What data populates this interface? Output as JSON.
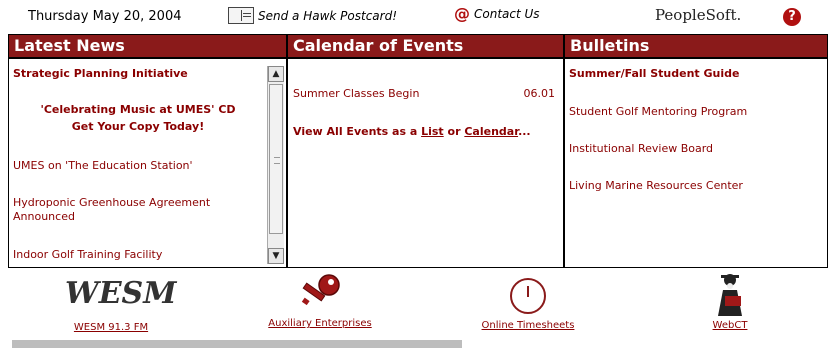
{
  "topbar": {
    "date": "Thursday May 20, 2004",
    "postcard_label": "Send a Hawk Postcard!",
    "contact_label": "Contact Us",
    "logo_text": "PeopleSoft.",
    "help_icon_glyph": "?"
  },
  "panels": {
    "news": {
      "title": "Latest News",
      "items": [
        "Strategic Planning Initiative",
        "'Celebrating Music at UMES' CD",
        "Get Your Copy Today!",
        "UMES on 'The Education Station'",
        "Hydroponic Greenhouse Agreement Announced",
        "Indoor Golf Training Facility"
      ]
    },
    "calendar": {
      "title": "Calendar of Events",
      "event_name": "Summer Classes Begin",
      "event_date": "06.01",
      "view_prefix": "View All Events as a ",
      "list_link": "List",
      "or_text": " or ",
      "calendar_link": "Calendar",
      "ellipsis": "..."
    },
    "bulletins": {
      "title": "Bulletins",
      "items": [
        "Summer/Fall Student Guide",
        "Student Golf Mentoring Program",
        "Institutional Review Board",
        "Living Marine Resources Center"
      ]
    }
  },
  "quicklinks": [
    {
      "label": "WESM 91.3 FM",
      "icon": "wesm-logo",
      "logo_text": "WESM"
    },
    {
      "label": "Auxiliary Enterprises",
      "icon": "key-icon"
    },
    {
      "label": "Online Timesheets",
      "icon": "clock-icon"
    },
    {
      "label": "WebCT",
      "icon": "webct-icon"
    }
  ],
  "colors": {
    "header_bg": "#8a1a1a",
    "link": "#8a0000"
  }
}
